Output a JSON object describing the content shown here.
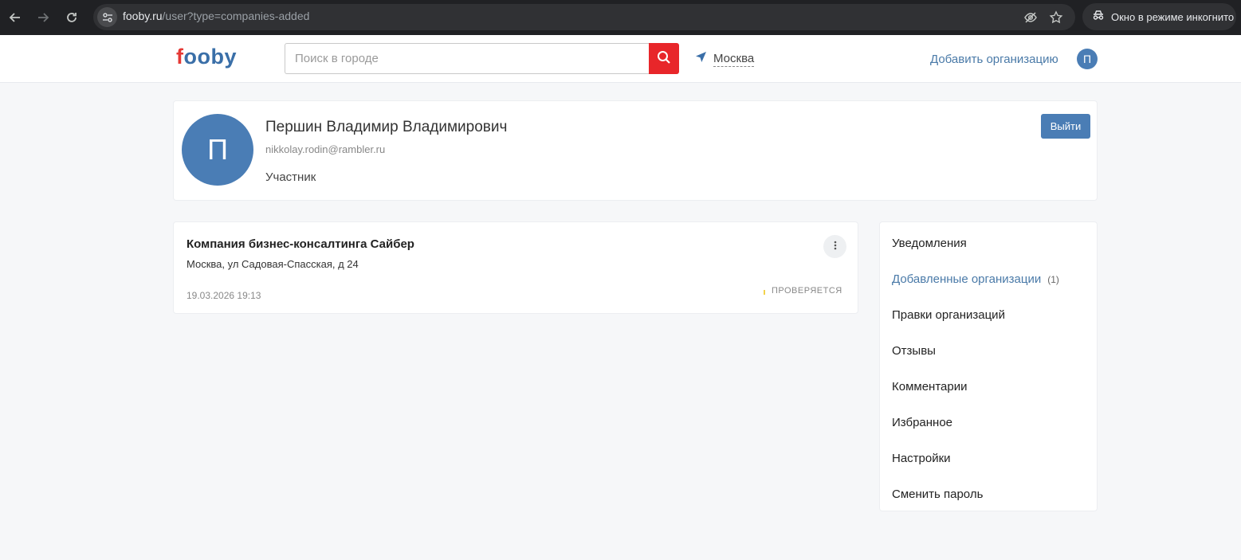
{
  "browser": {
    "url_domain": "fooby.ru",
    "url_path": "/user?type=companies-added",
    "incognito_label": "Окно в режиме инкогнито"
  },
  "header": {
    "logo_first": "f",
    "logo_rest": "ooby",
    "search_placeholder": "Поиск в городе",
    "city": "Москва",
    "add_org_label": "Добавить организацию",
    "avatar_letter": "П"
  },
  "profile": {
    "avatar_letter": "П",
    "name": "Першин Владимир Владимирович",
    "email": "nikkolay.rodin@rambler.ru",
    "role": "Участник",
    "logout_label": "Выйти"
  },
  "company": {
    "name": "Компания бизнес-консалтинга Сайбер",
    "address": "Москва, ул Садовая-Спасская, д 24",
    "date": "19.03.2026 19:13",
    "status": "ПРОВЕРЯЕТСЯ"
  },
  "menu": {
    "items": [
      {
        "label": "Уведомления"
      },
      {
        "label": "Добавленные организации",
        "count": "(1)",
        "active": true
      },
      {
        "label": "Правки организаций"
      },
      {
        "label": "Отзывы"
      },
      {
        "label": "Комментарии"
      },
      {
        "label": "Избранное"
      },
      {
        "label": "Настройки"
      },
      {
        "label": "Сменить пароль"
      }
    ]
  },
  "colors": {
    "brand_blue": "#4a7db5",
    "brand_red": "#e8262a",
    "status_yellow": "#f2d24b"
  }
}
